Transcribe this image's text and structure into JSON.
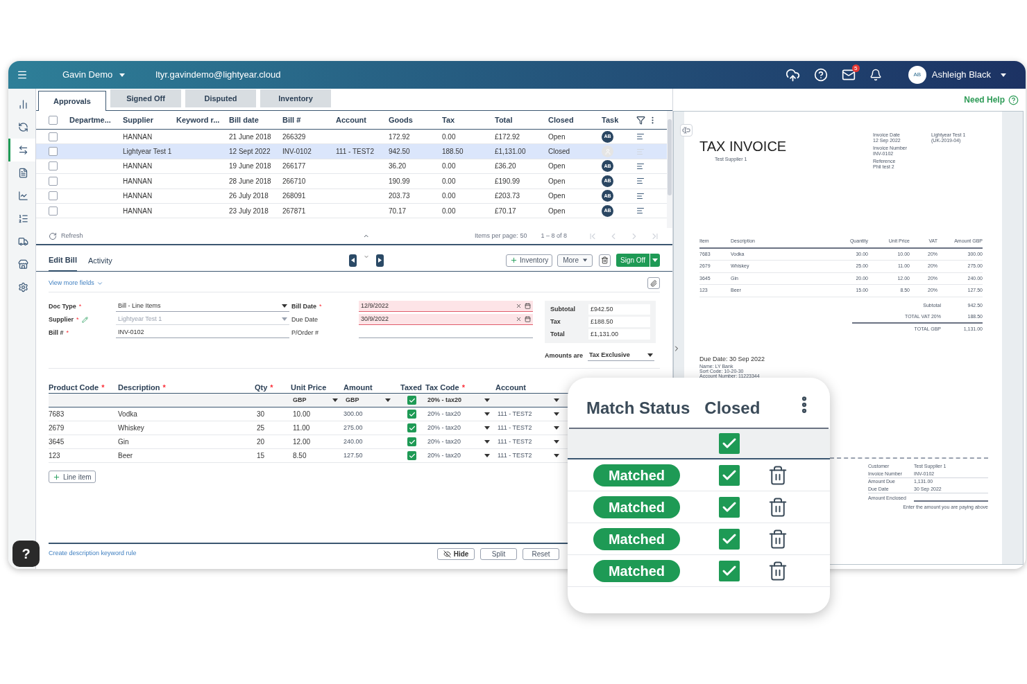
{
  "header": {
    "org": "Gavin Demo",
    "email": "ltyr.gavindemo@lightyear.cloud",
    "mail_badge": "5",
    "user": {
      "initials": "AB",
      "name": "Ashleigh Black"
    }
  },
  "sidebar": {
    "items": [
      {
        "kind": "chart",
        "selected": false
      },
      {
        "kind": "sync",
        "selected": false
      },
      {
        "kind": "transfer",
        "selected": true
      },
      {
        "kind": "document",
        "selected": false
      },
      {
        "kind": "trend",
        "selected": false
      },
      {
        "kind": "list",
        "selected": false
      },
      {
        "kind": "truck",
        "selected": false
      },
      {
        "kind": "store",
        "selected": false
      },
      {
        "kind": "settings",
        "selected": false
      }
    ]
  },
  "tabs": [
    {
      "label": "Approvals",
      "selected": true
    },
    {
      "label": "Signed Off",
      "selected": false
    },
    {
      "label": "Disputed",
      "selected": false
    },
    {
      "label": "Inventory",
      "selected": false
    }
  ],
  "need_help": "Need Help",
  "bills_table": {
    "select_all_checked": false,
    "columns": [
      "Departme...",
      "Supplier",
      "Keyword r...",
      "Bill date",
      "Bill #",
      "Account",
      "Goods",
      "Tax",
      "Total",
      "Closed",
      "Task"
    ],
    "rows": [
      {
        "checked": false,
        "selected": false,
        "supplier": "HANNAN",
        "bill_date": "21 June 2018",
        "bill_no": "266329",
        "goods": "172.92",
        "tax": "0.00",
        "total": "£172.92",
        "closed": "Open",
        "task": {
          "active": true,
          "initials": "AB"
        }
      },
      {
        "checked": false,
        "selected": true,
        "supplier": "Lightyear Test 1",
        "bill_date": "12 Sept 2022",
        "bill_no": "INV-0102",
        "account": "111 - TEST2",
        "goods": "942.50",
        "tax": "188.50",
        "total": "£1,131.00",
        "closed": "Closed",
        "task": {
          "active": false
        }
      },
      {
        "checked": false,
        "selected": false,
        "supplier": "HANNAN",
        "bill_date": "19 June 2018",
        "bill_no": "266177",
        "goods": "36.20",
        "tax": "0.00",
        "total": "£36.20",
        "closed": "Open",
        "task": {
          "active": true,
          "initials": "AB"
        }
      },
      {
        "checked": false,
        "selected": false,
        "supplier": "HANNAN",
        "bill_date": "28 June 2018",
        "bill_no": "266710",
        "goods": "190.99",
        "tax": "0.00",
        "total": "£190.99",
        "closed": "Open",
        "task": {
          "active": true,
          "initials": "AB"
        }
      },
      {
        "checked": false,
        "selected": false,
        "supplier": "HANNAN",
        "bill_date": "26 July 2018",
        "bill_no": "268091",
        "goods": "203.73",
        "tax": "0.00",
        "total": "£203.73",
        "closed": "Open",
        "task": {
          "active": true,
          "initials": "AB"
        }
      },
      {
        "checked": false,
        "selected": false,
        "supplier": "HANNAN",
        "bill_date": "23 July 2018",
        "bill_no": "267871",
        "goods": "70.17",
        "tax": "0.00",
        "total": "£70.17",
        "closed": "Open",
        "task": {
          "active": true,
          "initials": "AB"
        }
      }
    ],
    "footer": {
      "refresh": "Refresh",
      "items_per_page_label": "Items per page:",
      "items_per_page": "50",
      "range": "1 – 8 of 8"
    }
  },
  "edit_tabs": [
    {
      "label": "Edit Bill",
      "selected": true
    },
    {
      "label": "Activity",
      "selected": false
    }
  ],
  "actions": {
    "inventory": "Inventory",
    "more": "More",
    "sign_off": "Sign Off"
  },
  "view_more": "View more fields",
  "form": {
    "left": [
      {
        "label": "Doc Type",
        "required_mark": "*",
        "kind": "select",
        "value": "Bill - Line Items",
        "disabled": false,
        "editable": false
      },
      {
        "label": "Supplier",
        "required_mark": "*",
        "kind": "select",
        "value": "Lightyear Test 1",
        "disabled": true,
        "editable": true
      },
      {
        "label": "Bill #",
        "required_mark": "*",
        "kind": "text",
        "value": "INV-0102",
        "disabled": false,
        "editable": false
      }
    ],
    "right": [
      {
        "label": "Bill Date",
        "required_mark": "*",
        "kind": "date",
        "value": "12/9/2022",
        "invalid": true
      },
      {
        "label": "Due Date",
        "kind": "date",
        "value": "30/9/2022",
        "invalid": true
      },
      {
        "label": "P/Order #",
        "kind": "text",
        "invalid": false
      }
    ],
    "totals": [
      {
        "label": "Subtotal",
        "value": "£942.50"
      },
      {
        "label": "Tax",
        "value": "£188.50"
      },
      {
        "label": "Total",
        "value": "£1,131.00"
      }
    ],
    "amounts_are": {
      "label": "Amounts are",
      "value": "Tax Exclusive"
    }
  },
  "line_items": {
    "columns": [
      {
        "label": "Product Code",
        "required_mark": "*"
      },
      {
        "label": "Description",
        "required_mark": "*"
      },
      {
        "label": "Qty",
        "required_mark": "*"
      },
      {
        "label": "Unit Price"
      },
      {
        "label": "Amount"
      },
      {
        "label": "Taxed"
      },
      {
        "label": "Tax Code",
        "required_mark": "*"
      },
      {
        "label": "Account"
      }
    ],
    "defaults": {
      "unit_price": "GBP",
      "amount": "GBP",
      "taxed": true,
      "tax_code": "20% - tax20"
    },
    "rows": [
      {
        "product_code": "7683",
        "description": "Vodka",
        "qty": "30",
        "unit_price": "10.00",
        "amount": "300.00",
        "taxed": true,
        "tax_code": "20% - tax20",
        "account": "111 - TEST2"
      },
      {
        "product_code": "2679",
        "description": "Whiskey",
        "qty": "25",
        "unit_price": "11.00",
        "amount": "275.00",
        "taxed": true,
        "tax_code": "20% - tax20",
        "account": "111 - TEST2"
      },
      {
        "product_code": "3645",
        "description": "Gin",
        "qty": "20",
        "unit_price": "12.00",
        "amount": "240.00",
        "taxed": true,
        "tax_code": "20% - tax20",
        "account": "111 - TEST2"
      },
      {
        "product_code": "123",
        "description": "Beer",
        "qty": "15",
        "unit_price": "8.50",
        "amount": "127.50",
        "taxed": true,
        "tax_code": "20% - tax20",
        "account": "111 - TEST2"
      }
    ],
    "add_line": "Line item"
  },
  "keyword_rule": "Create description keyword rule",
  "footer_buttons": {
    "hide": "Hide",
    "split": "Split",
    "reset": "Reset"
  },
  "help_button": "?",
  "invoice": {
    "title": "TAX INVOICE",
    "supplier": "Test Supplier 1",
    "meta": [
      {
        "label": "Invoice Date",
        "value": "12 Sep 2022"
      },
      {
        "label": "Invoice Number",
        "value": "INV-0102"
      },
      {
        "label": "Reference",
        "value": "Phil test 2"
      }
    ],
    "recipient": [
      "Lightyear Test 1",
      "(UK-2019-04)"
    ],
    "columns": [
      "Item",
      "Description",
      "Quantity",
      "Unit Price",
      "VAT",
      "Amount GBP"
    ],
    "rows": [
      [
        "7683",
        "Vodka",
        "30.00",
        "10.00",
        "20%",
        "300.00"
      ],
      [
        "2679",
        "Whiskey",
        "25.00",
        "11.00",
        "20%",
        "275.00"
      ],
      [
        "3645",
        "Gin",
        "20.00",
        "12.00",
        "20%",
        "240.00"
      ],
      [
        "123",
        "Beer",
        "15.00",
        "8.50",
        "20%",
        "127.50"
      ]
    ],
    "summary": [
      {
        "label": "Subtotal",
        "value": "942.50"
      },
      {
        "label": "TOTAL VAT 20%",
        "value": "188.50"
      },
      {
        "label": "TOTAL GBP",
        "value": "1,131.00"
      }
    ],
    "due": "Due Date: 30 Sep 2022",
    "payment": [
      "Name: LY Bank",
      "Sort Code: 10-20-30",
      "Account Number: 11223344"
    ],
    "remittance": [
      {
        "label": "Customer",
        "value": "Test Supplier 1"
      },
      {
        "label": "Invoice Number",
        "value": "INV-0102"
      },
      {
        "label": "Amount Due",
        "value": "1,131.00"
      },
      {
        "label": "Due Date",
        "value": "30 Sep 2022"
      }
    ],
    "enclosed_label": "Amount Enclosed",
    "enclosed_hint": "Enter the amount you are paying above"
  },
  "match_popup": {
    "columns": [
      "Match Status",
      "Closed"
    ],
    "header_checked": true,
    "rows": [
      {
        "status": "Matched",
        "closed": true
      },
      {
        "status": "Matched",
        "closed": true
      },
      {
        "status": "Matched",
        "closed": true
      },
      {
        "status": "Matched",
        "closed": true
      }
    ]
  }
}
